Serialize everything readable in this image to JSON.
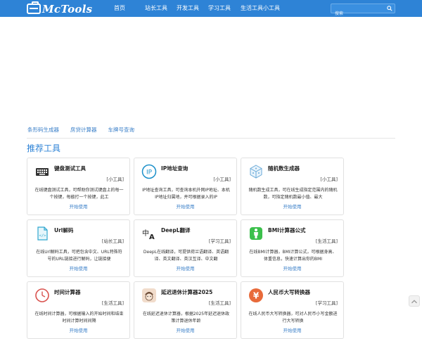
{
  "header": {
    "logo_text": "McTools",
    "nav": [
      "首页",
      "站长工具",
      "开发工具",
      "学习工具",
      "生活工具",
      "小工具"
    ],
    "search_placeholder": "搜索",
    "bg_color": "#2e83d6"
  },
  "quick_links": [
    "条形码生成器",
    "房贷计算器",
    "车牌号查询"
  ],
  "section_title": "推荐工具",
  "action_label": "开始使用",
  "cards": [
    {
      "title": "键盘测试工具",
      "tag": "[小工具]",
      "desc": "在线键盘测试工具，可帮助你测试键盘上的每一个按键，每敲打一个按键，此工",
      "icon": "keyboard-icon"
    },
    {
      "title": "IP地址查询",
      "tag": "[小工具]",
      "desc": "IP地址查询工具，可查询本机外网IP地址、本机IP地址归属地，并可根据录入的IP",
      "icon": "ip-icon"
    },
    {
      "title": "随机数生成器",
      "tag": "[小工具]",
      "desc": "随机数生成工具，可在线生成指定范围内的随机数，可指定随机数最小值、最大",
      "icon": "dice-icon"
    },
    {
      "title": "Url解码",
      "tag": "[站长工具]",
      "desc": "在线Url解码工具，可把包含中文、URL特殊符号的URL链接进行解码，让链接便",
      "icon": "url-file-icon"
    },
    {
      "title": "DeepL翻译",
      "tag": "[学习工具]",
      "desc": "DeepL在线翻译，可提供荷兰语翻译、英语翻译、英文翻译、英汉互译、中文翻",
      "icon": "translate-icon"
    },
    {
      "title": "BMI计算器公式",
      "tag": "[生活工具]",
      "desc": "在线BMI计算器，BMI计算公式，可根据身高、体重信息，快速计算出你的BMI",
      "icon": "bmi-icon"
    },
    {
      "title": "时间计算器",
      "tag": "[生活工具]",
      "desc": "在线时间计算器，可根据输入的开始时间和结束时间计算时间间隔",
      "icon": "clock-icon"
    },
    {
      "title": "延迟退休计算器2025",
      "tag": "[生活工具]",
      "desc": "在线延迟退休计算器，根据2025年延迟退休政策计算退休年龄",
      "icon": "retire-icon"
    },
    {
      "title": "人民币大写转换器",
      "tag": "[学习工具]",
      "desc": "在线人民币大写转换器，可对人民币小写金额进行大写转换",
      "icon": "yuan-icon"
    }
  ]
}
